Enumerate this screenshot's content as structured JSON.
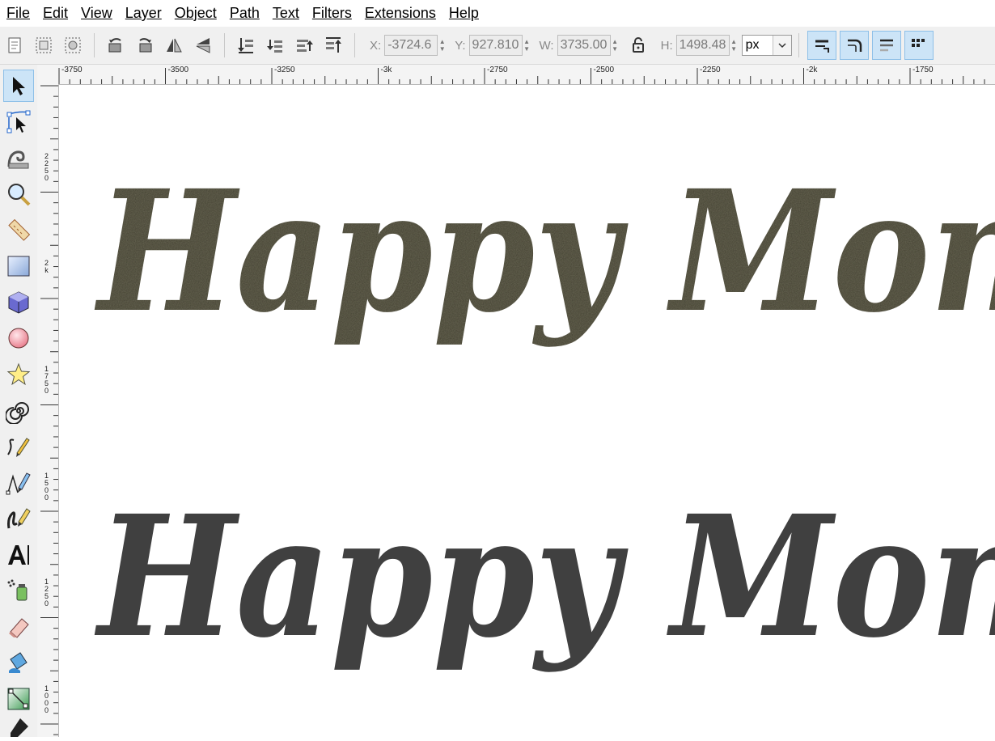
{
  "menu": [
    {
      "first": "F",
      "rest": "ile"
    },
    {
      "first": "E",
      "rest": "dit"
    },
    {
      "first": "V",
      "rest": "iew"
    },
    {
      "first": "L",
      "rest": "ayer"
    },
    {
      "first": "O",
      "rest": "bject"
    },
    {
      "first": "P",
      "rest": "ath"
    },
    {
      "first": "T",
      "rest": "ext"
    },
    {
      "first": "Filter",
      "rest": "s",
      "underline_last": true
    },
    {
      "first": "Exte",
      "rest": "nsions",
      "underline_mid": true
    },
    {
      "first": "H",
      "rest": "elp"
    }
  ],
  "menu_labels": [
    "File",
    "Edit",
    "View",
    "Layer",
    "Object",
    "Path",
    "Text",
    "Filters",
    "Extensions",
    "Help"
  ],
  "tool_controls": {
    "x_label": "X:",
    "x_value": "-3724.6",
    "y_label": "Y:",
    "y_value": "927.810",
    "w_label": "W:",
    "w_value": "3735.00",
    "h_label": "H:",
    "h_value": "1498.48",
    "unit": "px"
  },
  "ruler": {
    "top_labels": [
      "-3750",
      "-3500",
      "-3250",
      "-3k",
      "-2750",
      "-2500",
      "-2250",
      "-2k",
      "-1750"
    ],
    "left_labels": [
      "2250",
      "2k",
      "1750",
      "1500",
      "1250",
      "1000"
    ]
  },
  "canvas": {
    "text_top": "Happy Mon",
    "text_bottom": "Happy Mon",
    "top_fill": "#3f3d2f",
    "bottom_fill": "#404040"
  }
}
